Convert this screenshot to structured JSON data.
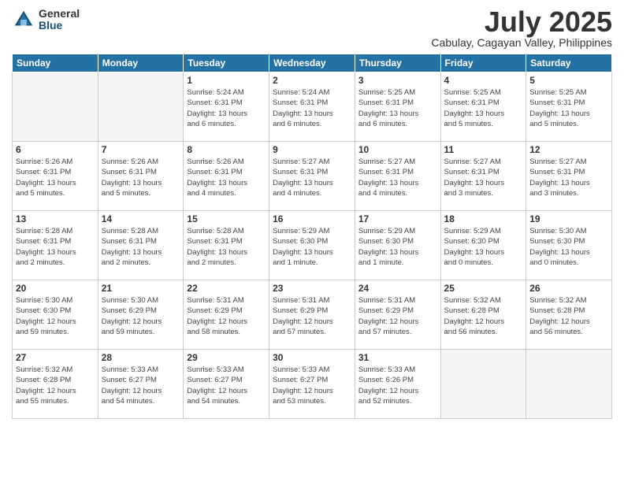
{
  "logo": {
    "general": "General",
    "blue": "Blue"
  },
  "title": {
    "month_year": "July 2025",
    "location": "Cabulay, Cagayan Valley, Philippines"
  },
  "weekdays": [
    "Sunday",
    "Monday",
    "Tuesday",
    "Wednesday",
    "Thursday",
    "Friday",
    "Saturday"
  ],
  "weeks": [
    [
      {
        "day": "",
        "info": ""
      },
      {
        "day": "",
        "info": ""
      },
      {
        "day": "1",
        "info": "Sunrise: 5:24 AM\nSunset: 6:31 PM\nDaylight: 13 hours\nand 6 minutes."
      },
      {
        "day": "2",
        "info": "Sunrise: 5:24 AM\nSunset: 6:31 PM\nDaylight: 13 hours\nand 6 minutes."
      },
      {
        "day": "3",
        "info": "Sunrise: 5:25 AM\nSunset: 6:31 PM\nDaylight: 13 hours\nand 6 minutes."
      },
      {
        "day": "4",
        "info": "Sunrise: 5:25 AM\nSunset: 6:31 PM\nDaylight: 13 hours\nand 5 minutes."
      },
      {
        "day": "5",
        "info": "Sunrise: 5:25 AM\nSunset: 6:31 PM\nDaylight: 13 hours\nand 5 minutes."
      }
    ],
    [
      {
        "day": "6",
        "info": "Sunrise: 5:26 AM\nSunset: 6:31 PM\nDaylight: 13 hours\nand 5 minutes."
      },
      {
        "day": "7",
        "info": "Sunrise: 5:26 AM\nSunset: 6:31 PM\nDaylight: 13 hours\nand 5 minutes."
      },
      {
        "day": "8",
        "info": "Sunrise: 5:26 AM\nSunset: 6:31 PM\nDaylight: 13 hours\nand 4 minutes."
      },
      {
        "day": "9",
        "info": "Sunrise: 5:27 AM\nSunset: 6:31 PM\nDaylight: 13 hours\nand 4 minutes."
      },
      {
        "day": "10",
        "info": "Sunrise: 5:27 AM\nSunset: 6:31 PM\nDaylight: 13 hours\nand 4 minutes."
      },
      {
        "day": "11",
        "info": "Sunrise: 5:27 AM\nSunset: 6:31 PM\nDaylight: 13 hours\nand 3 minutes."
      },
      {
        "day": "12",
        "info": "Sunrise: 5:27 AM\nSunset: 6:31 PM\nDaylight: 13 hours\nand 3 minutes."
      }
    ],
    [
      {
        "day": "13",
        "info": "Sunrise: 5:28 AM\nSunset: 6:31 PM\nDaylight: 13 hours\nand 2 minutes."
      },
      {
        "day": "14",
        "info": "Sunrise: 5:28 AM\nSunset: 6:31 PM\nDaylight: 13 hours\nand 2 minutes."
      },
      {
        "day": "15",
        "info": "Sunrise: 5:28 AM\nSunset: 6:31 PM\nDaylight: 13 hours\nand 2 minutes."
      },
      {
        "day": "16",
        "info": "Sunrise: 5:29 AM\nSunset: 6:30 PM\nDaylight: 13 hours\nand 1 minute."
      },
      {
        "day": "17",
        "info": "Sunrise: 5:29 AM\nSunset: 6:30 PM\nDaylight: 13 hours\nand 1 minute."
      },
      {
        "day": "18",
        "info": "Sunrise: 5:29 AM\nSunset: 6:30 PM\nDaylight: 13 hours\nand 0 minutes."
      },
      {
        "day": "19",
        "info": "Sunrise: 5:30 AM\nSunset: 6:30 PM\nDaylight: 13 hours\nand 0 minutes."
      }
    ],
    [
      {
        "day": "20",
        "info": "Sunrise: 5:30 AM\nSunset: 6:30 PM\nDaylight: 12 hours\nand 59 minutes."
      },
      {
        "day": "21",
        "info": "Sunrise: 5:30 AM\nSunset: 6:29 PM\nDaylight: 12 hours\nand 59 minutes."
      },
      {
        "day": "22",
        "info": "Sunrise: 5:31 AM\nSunset: 6:29 PM\nDaylight: 12 hours\nand 58 minutes."
      },
      {
        "day": "23",
        "info": "Sunrise: 5:31 AM\nSunset: 6:29 PM\nDaylight: 12 hours\nand 57 minutes."
      },
      {
        "day": "24",
        "info": "Sunrise: 5:31 AM\nSunset: 6:29 PM\nDaylight: 12 hours\nand 57 minutes."
      },
      {
        "day": "25",
        "info": "Sunrise: 5:32 AM\nSunset: 6:28 PM\nDaylight: 12 hours\nand 56 minutes."
      },
      {
        "day": "26",
        "info": "Sunrise: 5:32 AM\nSunset: 6:28 PM\nDaylight: 12 hours\nand 56 minutes."
      }
    ],
    [
      {
        "day": "27",
        "info": "Sunrise: 5:32 AM\nSunset: 6:28 PM\nDaylight: 12 hours\nand 55 minutes."
      },
      {
        "day": "28",
        "info": "Sunrise: 5:33 AM\nSunset: 6:27 PM\nDaylight: 12 hours\nand 54 minutes."
      },
      {
        "day": "29",
        "info": "Sunrise: 5:33 AM\nSunset: 6:27 PM\nDaylight: 12 hours\nand 54 minutes."
      },
      {
        "day": "30",
        "info": "Sunrise: 5:33 AM\nSunset: 6:27 PM\nDaylight: 12 hours\nand 53 minutes."
      },
      {
        "day": "31",
        "info": "Sunrise: 5:33 AM\nSunset: 6:26 PM\nDaylight: 12 hours\nand 52 minutes."
      },
      {
        "day": "",
        "info": ""
      },
      {
        "day": "",
        "info": ""
      }
    ]
  ]
}
